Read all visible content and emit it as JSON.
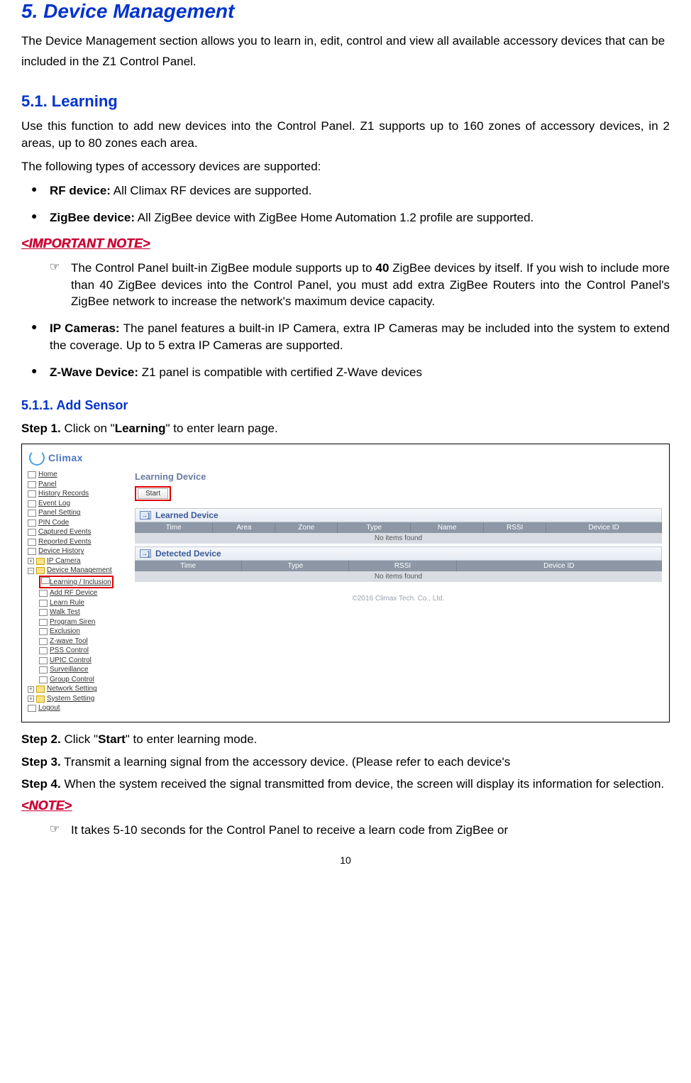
{
  "h1": "5.  Device Management",
  "intro": "The Device Management section allows you to learn in, edit, control and view all available accessory devices that can be included in the Z1 Control Panel.",
  "h2": "5.1. Learning",
  "p1": "Use this function to add new devices into the Control Panel. Z1 supports up to 160 zones of accessory devices, in 2 areas, up to 80 zones each area.",
  "p2": "The following types of accessory devices are supported:",
  "bullets": {
    "rf_label": "RF device:",
    "rf_text": " All Climax RF devices are supported.",
    "zb_label": "ZigBee device:",
    "zb_text": " All ZigBee device with ZigBee Home Automation 1.2 profile are supported.",
    "ip_label": "IP Cameras:",
    "ip_text": " The panel features a built-in IP Camera, extra IP Cameras may be included into the system to extend the coverage. Up to 5 extra IP Cameras are supported.",
    "zw_label": "Z-Wave Device:",
    "zw_text": " Z1 panel is compatible with certified Z-Wave devices"
  },
  "important_note_heading": "<IMPORTANT NOTE>",
  "important_note": {
    "prefix": "The Control Panel built-in ZigBee module supports up to ",
    "forty": "40",
    "suffix": " ZigBee devices by itself. If you wish to include more than 40 ZigBee devices into the Control Panel, you must add extra ZigBee Routers into the Control Panel's ZigBee network to increase the network's maximum device capacity."
  },
  "h3": "5.1.1. Add Sensor",
  "steps": {
    "s1_label": "Step 1.",
    "s1_a": "  Click on \"",
    "s1_b": "Learning",
    "s1_c": "\" to enter learn page.",
    "s2_label": "Step 2.",
    "s2_a": "  Click \"",
    "s2_b": "Start",
    "s2_c": "\" to enter learning mode.",
    "s3_label": "Step 3.",
    "s3_text": "  Transmit a learning signal from the accessory device. (Please refer to each device's",
    "s4_label": "Step 4.",
    "s4_text": "  When the system received the signal transmitted from device, the screen will display its information for selection."
  },
  "note_heading": "<NOTE>",
  "note_text": "It takes 5-10 seconds for the Control Panel to receive a learn code from ZigBee or",
  "page_number": "10",
  "screenshot": {
    "logo": "Climax",
    "sidebar": [
      "Home",
      "Panel",
      "History Records",
      "Event Log",
      "Panel Setting",
      "PIN Code",
      "Captured Events",
      "Reported Events",
      "Device History",
      "IP Camera",
      "Device Management",
      "Learning / Inclusion",
      "Add RF Device",
      "Learn Rule",
      "Walk Test",
      "Program Siren",
      "Exclusion",
      "Z-wave Tool",
      "PSS Control",
      "UPIC Control",
      "Surveillance",
      "Group Control",
      "Network Setting",
      "System Setting",
      "Logout"
    ],
    "panel_title": "Learning Device",
    "start_btn": "Start",
    "learned_title": "Learned Device",
    "learned_cols": [
      "Time",
      "Area",
      "Zone",
      "Type",
      "Name",
      "RSSI",
      "Device ID"
    ],
    "no_items": "No items found",
    "detected_title": "Detected Device",
    "detected_cols": [
      "Time",
      "Type",
      "RSSI",
      "Device ID"
    ],
    "copyright": "©2016 Climax Tech. Co., Ltd."
  }
}
